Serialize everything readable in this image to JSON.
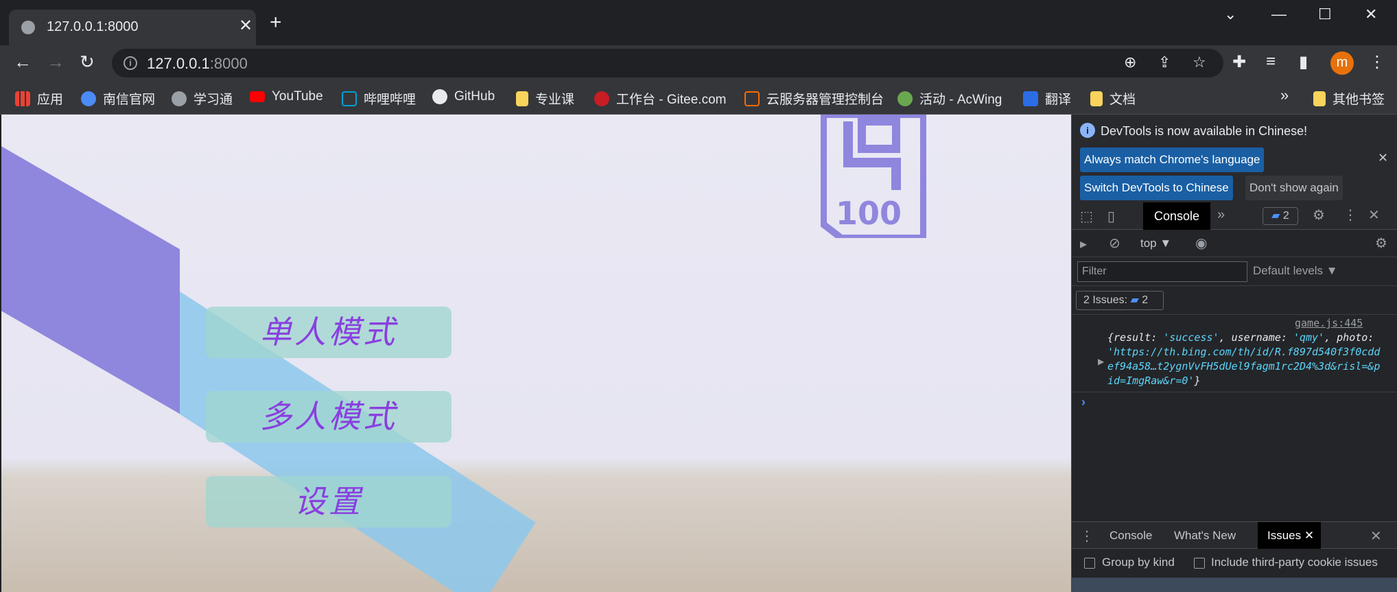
{
  "browser": {
    "tab_title": "127.0.0.1:8000",
    "url_host": "127.0.0.1",
    "url_port": ":8000",
    "avatar_letter": "m"
  },
  "bookmarks": [
    {
      "label": "应用",
      "color": "#e8710a"
    },
    {
      "label": "南信官网",
      "color": "#4c8bf5"
    },
    {
      "label": "学习通",
      "color": "#9aa0a6"
    },
    {
      "label": "YouTube",
      "color": "#ff0000"
    },
    {
      "label": "哔哩哔哩",
      "color": "#00a1d6"
    },
    {
      "label": "GitHub",
      "color": "#e8eaed"
    },
    {
      "label": "专业课",
      "color": "#f9d45c"
    },
    {
      "label": "工作台 - Gitee.com",
      "color": "#c71d23"
    },
    {
      "label": "云服务器管理控制台",
      "color": "#ff6a00"
    },
    {
      "label": "活动 - AcWing",
      "color": "#6aa84f"
    },
    {
      "label": "翻译",
      "color": "#2b6de5"
    },
    {
      "label": "文档",
      "color": "#f9d45c"
    }
  ],
  "bookmarks_more": "»",
  "other_bookmarks": "其他书签",
  "game": {
    "single_mode": "单人模式",
    "multi_mode": "多人模式",
    "settings": "设置",
    "logo_text": "100"
  },
  "devtools": {
    "banner_text": "DevTools is now available in Chinese!",
    "btn_match": "Always match Chrome's language",
    "btn_switch": "Switch DevTools to Chinese",
    "btn_dont_show": "Don't show again",
    "console_tab": "Console",
    "issues_badge": "2",
    "context": "top ▼",
    "filter_placeholder": "Filter",
    "levels": "Default levels ▼",
    "issues_pill": "2 Issues:",
    "issues_pill_count": "2",
    "log_source": "game.js:445",
    "log_key1": "{result: ",
    "log_val1": "'success'",
    "log_key2": ", username: ",
    "log_val2": "'qmy'",
    "log_key3": ", photo: ",
    "log_val3": "'https://th.bing.com/th/id/R.f897d540f3f0cddef94a58…t2ygnVvFH5dUel9fagm1rc2D4%3d&risl=&pid=ImgRaw&r=0'",
    "log_end": "}",
    "drawer_console": "Console",
    "drawer_whats_new": "What's New",
    "drawer_issues": "Issues",
    "group_by_kind": "Group by kind",
    "third_party": "Include third-party cookie issues"
  },
  "colors": {
    "accent_blue": "#1a5fa4",
    "menu_text": "#8a3fe0",
    "menu_bg": "#a0d6d0"
  }
}
